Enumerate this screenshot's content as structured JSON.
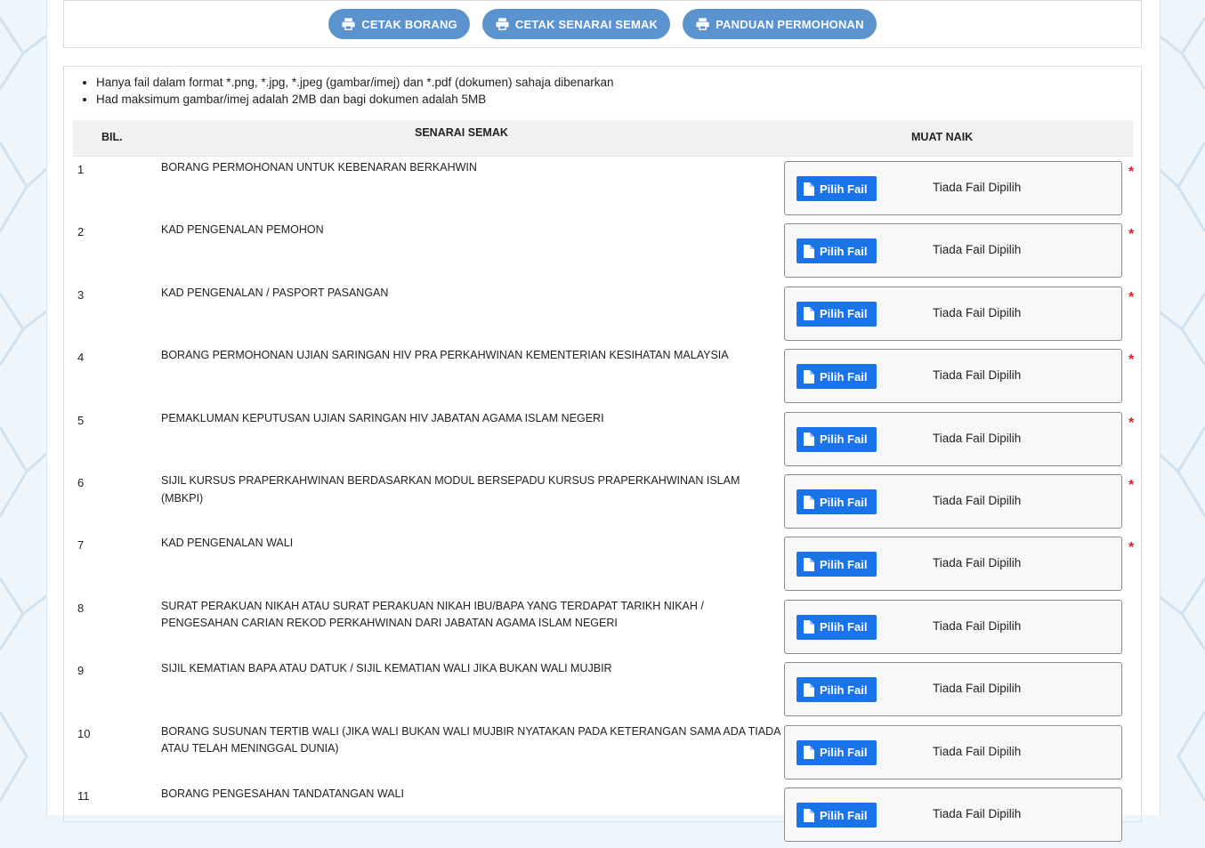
{
  "actions": {
    "cetak_borang": "CETAK BORANG",
    "cetak_senarai": "CETAK SENARAI SEMAK",
    "panduan": "PANDUAN PERMOHONAN"
  },
  "notes": [
    "Hanya fail dalam format *.png, *.jpg, *.jpeg (gambar/imej) dan *.pdf (dokumen) sahaja dibenarkan",
    "Had maksimum gambar/imej adalah 2MB dan bagi dokumen adalah 5MB"
  ],
  "table": {
    "headers": {
      "bil": "BIL.",
      "senarai": "SENARAI SEMAK",
      "muat": "MUAT NAIK"
    },
    "pick_label": "Pilih Fail",
    "no_file_label": "Tiada Fail Dipilih",
    "required_mark": "*",
    "rows": [
      {
        "num": "1",
        "desc": "BORANG PERMOHONAN UNTUK KEBENARAN BERKAHWIN",
        "required": true
      },
      {
        "num": "2",
        "desc": "KAD PENGENALAN PEMOHON",
        "required": true
      },
      {
        "num": "3",
        "desc": "KAD PENGENALAN / PASPORT PASANGAN",
        "required": true
      },
      {
        "num": "4",
        "desc": "BORANG PERMOHONAN UJIAN SARINGAN HIV PRA PERKAHWINAN KEMENTERIAN KESIHATAN MALAYSIA",
        "required": true
      },
      {
        "num": "5",
        "desc": "PEMAKLUMAN KEPUTUSAN UJIAN SARINGAN HIV JABATAN AGAMA ISLAM NEGERI",
        "required": true
      },
      {
        "num": "6",
        "desc": "SIJIL KURSUS PRAPERKAHWINAN BERDASARKAN MODUL BERSEPADU KURSUS PRAPERKAHWINAN ISLAM (MBKPI)",
        "required": true
      },
      {
        "num": "7",
        "desc": "KAD PENGENALAN WALI",
        "required": true
      },
      {
        "num": "8",
        "desc": "SURAT PERAKUAN NIKAH ATAU SURAT PERAKUAN NIKAH IBU/BAPA YANG TERDAPAT TARIKH NIKAH / PENGESAHAN CARIAN REKOD PERKAHWINAN DARI JABATAN AGAMA ISLAM NEGERI",
        "required": false
      },
      {
        "num": "9",
        "desc": "SIJIL KEMATIAN BAPA ATAU DATUK / SIJIL KEMATIAN WALI JIKA BUKAN WALI MUJBIR",
        "required": false
      },
      {
        "num": "10",
        "desc": "BORANG SUSUNAN TERTIB WALI (JIKA WALI BUKAN WALI MUJBIR NYATAKAN PADA KETERANGAN SAMA ADA TIADA ATAU TELAH MENINGGAL DUNIA)",
        "required": false
      },
      {
        "num": "11",
        "desc": "BORANG PENGESAHAN TANDATANGAN WALI",
        "required": false
      }
    ]
  }
}
